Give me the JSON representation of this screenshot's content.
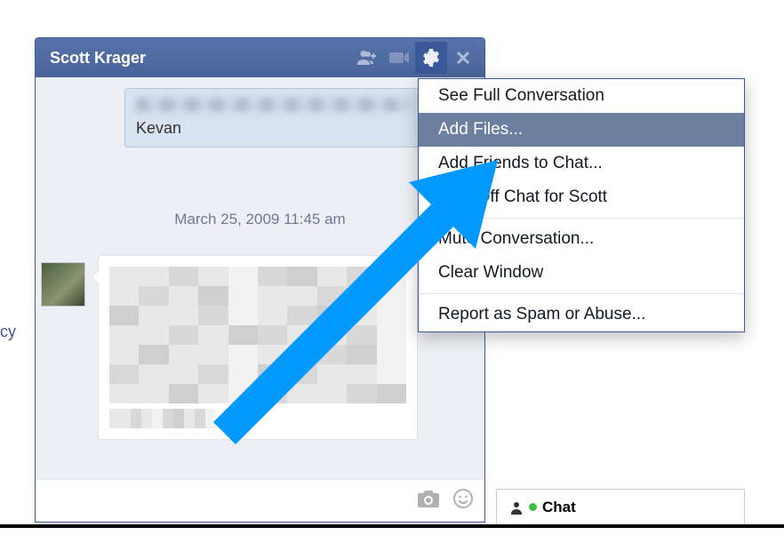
{
  "partial": "cy",
  "chat": {
    "title": "Scott Krager",
    "quoted_name": "Kevan",
    "timestamp": "March 25, 2009 11:45 am"
  },
  "menu": {
    "see_full": "See Full Conversation",
    "add_files": "Add Files...",
    "add_friends": "Add Friends to Chat...",
    "turn_off": "Turn Off Chat for Scott",
    "mute": "Mute Conversation...",
    "clear": "Clear Window",
    "report": "Report as Spam or Abuse..."
  },
  "chat_tab": {
    "label": "Chat"
  }
}
